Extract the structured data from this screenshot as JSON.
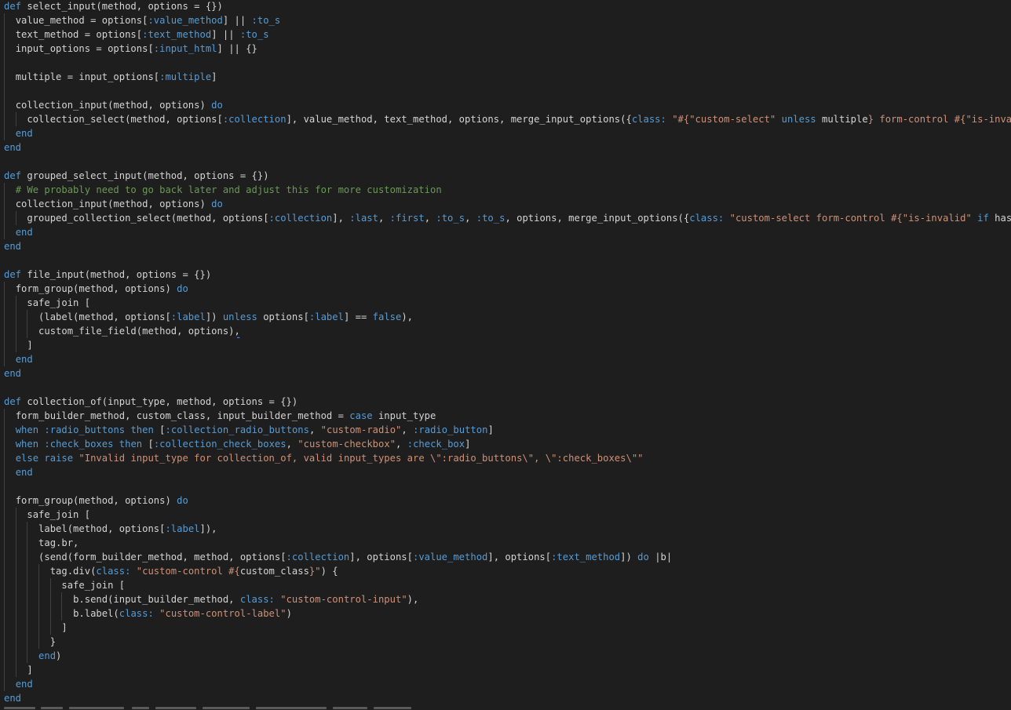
{
  "editor": {
    "theme": {
      "background": "#1e1e1e",
      "foreground": "#d4d4d4",
      "keyword": "#569cd6",
      "symbol": "#569cd6",
      "string": "#ce9178",
      "comment": "#6a9955",
      "indent_guide": "#404040"
    },
    "lines": [
      {
        "indent": 0,
        "tokens": [
          [
            "kw",
            "def"
          ],
          [
            "plain",
            " select_input(method, options = {})"
          ]
        ]
      },
      {
        "indent": 1,
        "tokens": [
          [
            "plain",
            "value_method = options["
          ],
          [
            "sym",
            ":value_method"
          ],
          [
            "plain",
            "] || "
          ],
          [
            "sym",
            ":to_s"
          ]
        ]
      },
      {
        "indent": 1,
        "tokens": [
          [
            "plain",
            "text_method = options["
          ],
          [
            "sym",
            ":text_method"
          ],
          [
            "plain",
            "] || "
          ],
          [
            "sym",
            ":to_s"
          ]
        ]
      },
      {
        "indent": 1,
        "tokens": [
          [
            "plain",
            "input_options = options["
          ],
          [
            "sym",
            ":input_html"
          ],
          [
            "plain",
            "] || {}"
          ]
        ]
      },
      {
        "indent": 1,
        "tokens": []
      },
      {
        "indent": 1,
        "tokens": [
          [
            "plain",
            "multiple = input_options["
          ],
          [
            "sym",
            ":multiple"
          ],
          [
            "plain",
            "]"
          ]
        ]
      },
      {
        "indent": 1,
        "tokens": []
      },
      {
        "indent": 1,
        "tokens": [
          [
            "plain",
            "collection_input(method, options) "
          ],
          [
            "kw",
            "do"
          ]
        ]
      },
      {
        "indent": 2,
        "tokens": [
          [
            "plain",
            "collection_select(method, options["
          ],
          [
            "sym",
            ":collection"
          ],
          [
            "plain",
            "], value_method, text_method, options, merge_input_options({"
          ],
          [
            "sym",
            "class:"
          ],
          [
            "plain",
            " "
          ],
          [
            "str",
            "\"#{"
          ],
          [
            "str",
            "\"custom-select\""
          ],
          [
            "plain",
            " "
          ],
          [
            "kw",
            "unless"
          ],
          [
            "plain",
            " multiple"
          ],
          [
            "str",
            "}"
          ],
          [
            "str",
            " form-control #{"
          ],
          [
            "str",
            "\"is-invalid\""
          ]
        ]
      },
      {
        "indent": 1,
        "tokens": [
          [
            "kw",
            "end"
          ]
        ]
      },
      {
        "indent": 0,
        "tokens": [
          [
            "kw",
            "end"
          ]
        ]
      },
      {
        "indent": 0,
        "tokens": []
      },
      {
        "indent": 0,
        "tokens": [
          [
            "kw",
            "def"
          ],
          [
            "plain",
            " grouped_select_input(method, options = {})"
          ]
        ]
      },
      {
        "indent": 1,
        "tokens": [
          [
            "cmt",
            "# We probably need to go back later and adjust this for more customization"
          ]
        ]
      },
      {
        "indent": 1,
        "tokens": [
          [
            "plain",
            "collection_input(method, options) "
          ],
          [
            "kw",
            "do"
          ]
        ]
      },
      {
        "indent": 2,
        "tokens": [
          [
            "plain",
            "grouped_collection_select(method, options["
          ],
          [
            "sym",
            ":collection"
          ],
          [
            "plain",
            "], "
          ],
          [
            "sym",
            ":last"
          ],
          [
            "plain",
            ", "
          ],
          [
            "sym",
            ":first"
          ],
          [
            "plain",
            ", "
          ],
          [
            "sym",
            ":to_s"
          ],
          [
            "plain",
            ", "
          ],
          [
            "sym",
            ":to_s"
          ],
          [
            "plain",
            ", options, merge_input_options({"
          ],
          [
            "sym",
            "class:"
          ],
          [
            "plain",
            " "
          ],
          [
            "str",
            "\"custom-select form-control #{"
          ],
          [
            "str",
            "\"is-invalid\""
          ],
          [
            "plain",
            " "
          ],
          [
            "kw",
            "if"
          ],
          [
            "plain",
            " has_err"
          ]
        ]
      },
      {
        "indent": 1,
        "tokens": [
          [
            "kw",
            "end"
          ]
        ]
      },
      {
        "indent": 0,
        "tokens": [
          [
            "kw",
            "end"
          ]
        ]
      },
      {
        "indent": 0,
        "tokens": []
      },
      {
        "indent": 0,
        "tokens": [
          [
            "kw",
            "def"
          ],
          [
            "plain",
            " file_input(method, options = {})"
          ]
        ]
      },
      {
        "indent": 1,
        "tokens": [
          [
            "plain",
            "form_group(method, options) "
          ],
          [
            "kw",
            "do"
          ]
        ]
      },
      {
        "indent": 2,
        "tokens": [
          [
            "plain",
            "safe_join ["
          ]
        ]
      },
      {
        "indent": 3,
        "tokens": [
          [
            "plain",
            "(label(method, options["
          ],
          [
            "sym",
            ":label"
          ],
          [
            "plain",
            "]) "
          ],
          [
            "kw",
            "unless"
          ],
          [
            "plain",
            " options["
          ],
          [
            "sym",
            ":label"
          ],
          [
            "plain",
            "] == "
          ],
          [
            "kw",
            "false"
          ],
          [
            "plain",
            "),"
          ]
        ]
      },
      {
        "indent": 3,
        "tokens": [
          [
            "plain",
            "custom_file_field(method, options)"
          ],
          [
            "squig",
            ","
          ]
        ]
      },
      {
        "indent": 2,
        "tokens": [
          [
            "plain",
            "]"
          ]
        ]
      },
      {
        "indent": 1,
        "tokens": [
          [
            "kw",
            "end"
          ]
        ]
      },
      {
        "indent": 0,
        "tokens": [
          [
            "kw",
            "end"
          ]
        ]
      },
      {
        "indent": 0,
        "tokens": []
      },
      {
        "indent": 0,
        "tokens": [
          [
            "kw",
            "def"
          ],
          [
            "plain",
            " collection_of(input_type, method, options = {})"
          ]
        ]
      },
      {
        "indent": 1,
        "tokens": [
          [
            "plain",
            "form_builder_method, custom_class, input_builder_method = "
          ],
          [
            "kw",
            "case"
          ],
          [
            "plain",
            " input_type"
          ]
        ]
      },
      {
        "indent": 1,
        "tokens": [
          [
            "kw",
            "when"
          ],
          [
            "plain",
            " "
          ],
          [
            "sym",
            ":radio_buttons"
          ],
          [
            "plain",
            " "
          ],
          [
            "kw",
            "then"
          ],
          [
            "plain",
            " ["
          ],
          [
            "sym",
            ":collection_radio_buttons"
          ],
          [
            "plain",
            ", "
          ],
          [
            "str",
            "\"custom-radio\""
          ],
          [
            "plain",
            ", "
          ],
          [
            "sym",
            ":radio_button"
          ],
          [
            "plain",
            "]"
          ]
        ]
      },
      {
        "indent": 1,
        "tokens": [
          [
            "kw",
            "when"
          ],
          [
            "plain",
            " "
          ],
          [
            "sym",
            ":check_boxes"
          ],
          [
            "plain",
            " "
          ],
          [
            "kw",
            "then"
          ],
          [
            "plain",
            " ["
          ],
          [
            "sym",
            ":collection_check_boxes"
          ],
          [
            "plain",
            ", "
          ],
          [
            "str",
            "\"custom-checkbox\""
          ],
          [
            "plain",
            ", "
          ],
          [
            "sym",
            ":check_box"
          ],
          [
            "plain",
            "]"
          ]
        ]
      },
      {
        "indent": 1,
        "tokens": [
          [
            "kw",
            "else"
          ],
          [
            "plain",
            " "
          ],
          [
            "kw",
            "raise"
          ],
          [
            "plain",
            " "
          ],
          [
            "str",
            "\"Invalid input_type for collection_of, valid input_types are \\\":radio_buttons\\\", \\\":check_boxes\\\"\""
          ]
        ]
      },
      {
        "indent": 1,
        "tokens": [
          [
            "kw",
            "end"
          ]
        ]
      },
      {
        "indent": 1,
        "tokens": []
      },
      {
        "indent": 1,
        "tokens": [
          [
            "plain",
            "form_group(method, options) "
          ],
          [
            "kw",
            "do"
          ]
        ]
      },
      {
        "indent": 2,
        "tokens": [
          [
            "plain",
            "safe_join ["
          ]
        ]
      },
      {
        "indent": 3,
        "tokens": [
          [
            "plain",
            "label(method, options["
          ],
          [
            "sym",
            ":label"
          ],
          [
            "plain",
            "]),"
          ]
        ]
      },
      {
        "indent": 3,
        "tokens": [
          [
            "plain",
            "tag.br,"
          ]
        ]
      },
      {
        "indent": 3,
        "tokens": [
          [
            "plain",
            "(send(form_builder_method, method, options["
          ],
          [
            "sym",
            ":collection"
          ],
          [
            "plain",
            "], options["
          ],
          [
            "sym",
            ":value_method"
          ],
          [
            "plain",
            "], options["
          ],
          [
            "sym",
            ":text_method"
          ],
          [
            "plain",
            "]) "
          ],
          [
            "kw",
            "do"
          ],
          [
            "plain",
            " |b|"
          ]
        ]
      },
      {
        "indent": 4,
        "tokens": [
          [
            "plain",
            "tag.div("
          ],
          [
            "sym",
            "class:"
          ],
          [
            "plain",
            " "
          ],
          [
            "str",
            "\"custom-control #{"
          ],
          [
            "plain",
            "custom_class"
          ],
          [
            "str",
            "}\""
          ],
          [
            "plain",
            ") {"
          ]
        ]
      },
      {
        "indent": 5,
        "tokens": [
          [
            "plain",
            "safe_join ["
          ]
        ]
      },
      {
        "indent": 6,
        "tokens": [
          [
            "plain",
            "b.send(input_builder_method, "
          ],
          [
            "sym",
            "class:"
          ],
          [
            "plain",
            " "
          ],
          [
            "str",
            "\"custom-control-input\""
          ],
          [
            "plain",
            "),"
          ]
        ]
      },
      {
        "indent": 6,
        "tokens": [
          [
            "plain",
            "b.label("
          ],
          [
            "sym",
            "class:"
          ],
          [
            "plain",
            " "
          ],
          [
            "str",
            "\"custom-control-label\""
          ],
          [
            "plain",
            ")"
          ]
        ]
      },
      {
        "indent": 5,
        "tokens": [
          [
            "plain",
            "]"
          ]
        ]
      },
      {
        "indent": 4,
        "tokens": [
          [
            "plain",
            "}"
          ]
        ]
      },
      {
        "indent": 3,
        "tokens": [
          [
            "kw",
            "end"
          ],
          [
            "plain",
            ")"
          ]
        ]
      },
      {
        "indent": 2,
        "tokens": [
          [
            "plain",
            "]"
          ]
        ]
      },
      {
        "indent": 1,
        "tokens": [
          [
            "kw",
            "end"
          ]
        ]
      },
      {
        "indent": 0,
        "tokens": [
          [
            "kw",
            "end"
          ]
        ]
      }
    ]
  }
}
